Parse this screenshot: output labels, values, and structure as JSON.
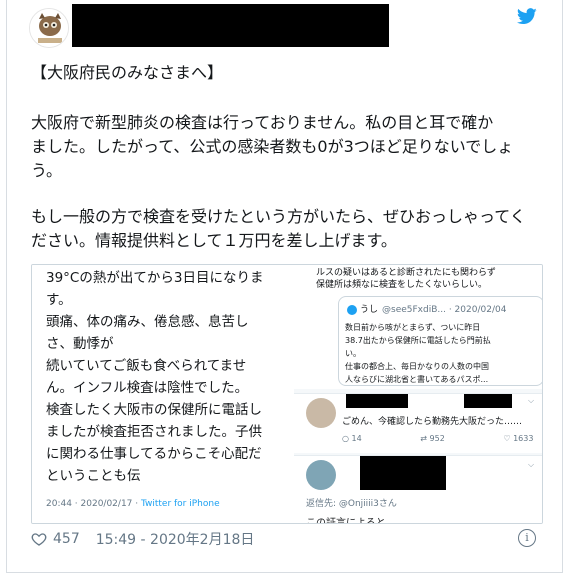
{
  "colors": {
    "brand": "#1da1f2",
    "text": "#14171a",
    "muted": "#657786",
    "redaction": "#000000"
  },
  "header": {
    "twitter_icon": "twitter-bird-icon"
  },
  "tweet": {
    "line1": "【大阪府民のみなさまへ】",
    "line2": "大阪府で新型肺炎の検査は行っておりません。私の目と耳で確か",
    "line3": "ました。したがって、公式の感染者数も0が3つほど足りないでしょ",
    "line4": "う。",
    "line5": "もし一般の方で検査を受けたという方がいたら、ぜひおっしゃってく",
    "line6": "ださい。情報提供料として１万円を差し上げます。"
  },
  "media_left": {
    "lines": [
      "39°Cの熱が出てから3日目になりま",
      "す。",
      "頭痛、体の痛み、倦怠感、息苦し",
      "さ、動悸が",
      "続いていてご飯も食べられてませ",
      "ん。インフル検査は陰性でした。",
      "検査したく大阪市の保健所に電話し",
      "ましたが検査拒否されました。子供",
      "に関わる仕事してるからこそ心配だ",
      "ということも伝"
    ],
    "timestamp": "20:44 · 2020/02/17 · ",
    "source": "Twitter for iPhone"
  },
  "media_right": {
    "top_line1": "ルスの疑いはあると診断されたにも関わらず",
    "top_line2": "保健所は頻なに検査をしたくないらしい。",
    "quote_name": "うし",
    "quote_handle": "@see5FxdiB... · 2020/02/04",
    "quote_lines": [
      "数日前から咳がとまらず、ついに昨日",
      "38.7出たから保健所に電話したら門前払",
      "い。",
      "仕事の都合上、毎日かなりの人数の中国",
      "人ならびに湖北省と書いてあるパスポ..."
    ],
    "reply1_text": "ごめん、今確認したら勤務先大阪だった……",
    "reply1_replies": "14",
    "reply1_retweets": "952",
    "reply1_likes": "1633",
    "reply2_to": "返信先: @Onjiiii3さん",
    "reply2_text": "この証言によると"
  },
  "footer": {
    "likes": "457",
    "timestamp": "15:49 - 2020年2月18日",
    "info": "i"
  }
}
